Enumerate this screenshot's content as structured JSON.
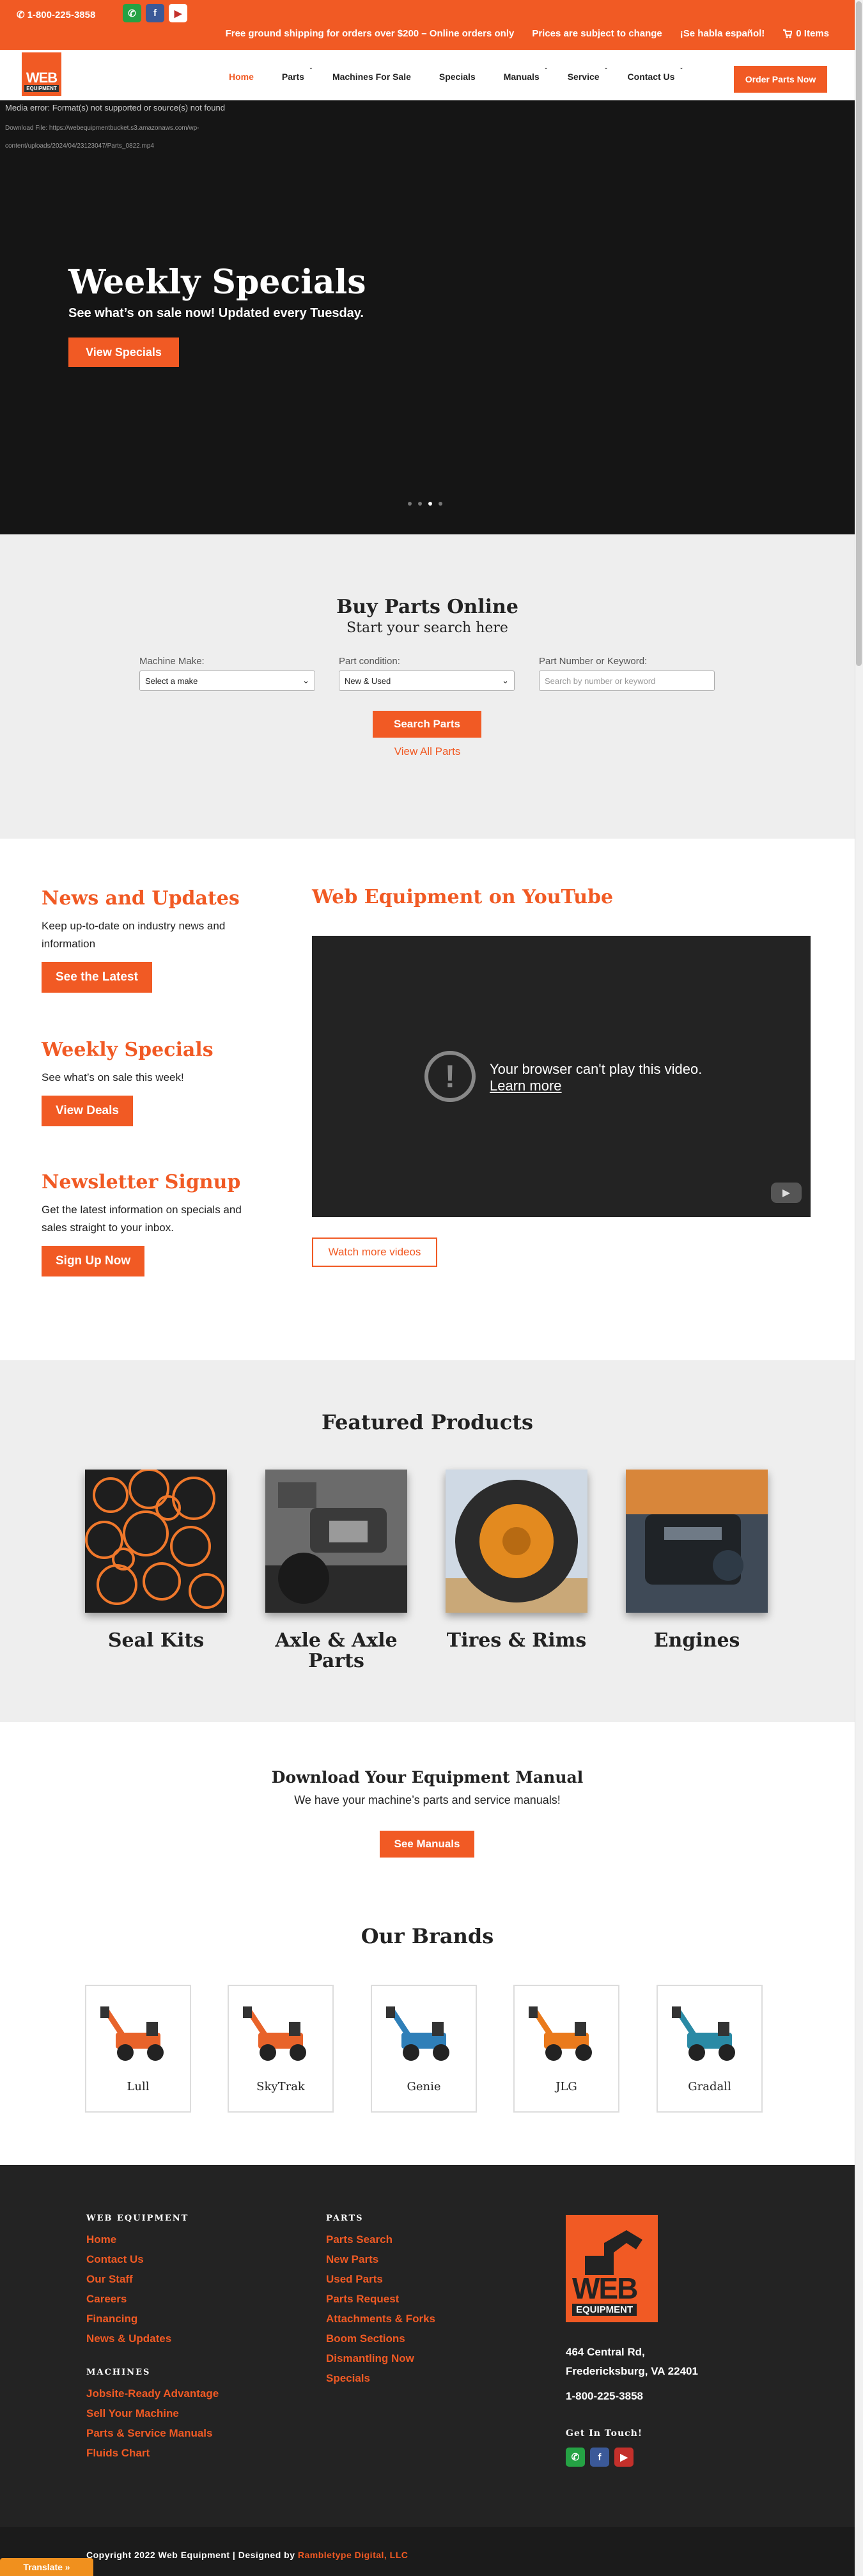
{
  "topbar": {
    "phone": "1-800-225-3858",
    "shipping": "Free ground shipping for orders over $200 – Online orders only",
    "prices": "Prices are subject to change",
    "spanish": "¡Se habla español!",
    "cart": "0 Items"
  },
  "header": {
    "logo_text": "WEB",
    "logo_sub": "EQUIPMENT",
    "nav": [
      "Home",
      "Parts",
      "Machines For Sale",
      "Specials",
      "Manuals",
      "Service",
      "Contact Us"
    ],
    "order_button": "Order Parts Now"
  },
  "hero": {
    "media_error": "Media error: Format(s) not supported or source(s) not found",
    "download_text": "Download File: https://webequipmentbucket.s3.amazonaws.com/wp-content/uploads/2024/04/23123047/Parts_0822.mp4",
    "title": "Weekly Specials",
    "subtitle": "See what’s on sale now! Updated every Tuesday.",
    "button": "View Specials",
    "active_slide": 3
  },
  "buy_parts": {
    "title": "Buy Parts Online",
    "subtitle": "Start your search here",
    "make_label": "Machine Make:",
    "make_value": "Select a make",
    "condition_label": "Part condition:",
    "condition_value": "New & Used",
    "keyword_label": "Part Number or Keyword:",
    "keyword_placeholder": "Search by number or keyword",
    "search_button": "Search Parts",
    "view_all": "View All Parts"
  },
  "news": {
    "news_title": "News and Updates",
    "news_text": "Keep up-to-date on industry news and information",
    "news_button": "See the Latest",
    "specials_title": "Weekly Specials",
    "specials_text": "See what’s on sale this week!",
    "specials_button": "View Deals",
    "newsletter_title": "Newsletter Signup",
    "newsletter_text": "Get the latest information on specials and sales straight to your inbox.",
    "newsletter_button": "Sign Up Now",
    "youtube_title": "Web Equipment on YouTube",
    "video_message": "Your browser can't play this video.",
    "video_learn": "Learn more",
    "watch_button": "Watch more videos"
  },
  "featured": {
    "title": "Featured Products",
    "products": [
      "Seal Kits",
      "Axle & Axle Parts",
      "Tires & Rims",
      "Engines"
    ]
  },
  "manuals": {
    "title": "Download Your Equipment Manual",
    "text": "We have your machine’s parts and service manuals!",
    "button": "See Manuals"
  },
  "brands": {
    "title": "Our Brands",
    "items": [
      {
        "name": "Lull",
        "color": "#e8632a"
      },
      {
        "name": "SkyTrak",
        "color": "#e8632a"
      },
      {
        "name": "Genie",
        "color": "#2f7fb8"
      },
      {
        "name": "JLG",
        "color": "#ea7a1c"
      },
      {
        "name": "Gradall",
        "color": "#2a8aa5"
      }
    ]
  },
  "footer": {
    "col1_heading": "WEB EQUIPMENT",
    "col1_links": [
      "Home",
      "Contact Us",
      "Our Staff",
      "Careers",
      "Financing",
      "News & Updates"
    ],
    "col1b_heading": "MACHINES",
    "col1b_links": [
      "Jobsite-Ready Advantage",
      "Sell Your Machine",
      "Parts & Service Manuals",
      "Fluids Chart"
    ],
    "col2_heading": "PARTS",
    "col2_links": [
      "Parts Search",
      "New Parts",
      "Used Parts",
      "Parts Request",
      "Attachments & Forks",
      "Boom Sections",
      "Dismantling Now",
      "Specials"
    ],
    "address1": "464 Central Rd,",
    "address2": "Fredericksburg, VA 22401",
    "phone": "1-800-225-3858",
    "get_in_touch": "Get In Touch!",
    "copyright": "Copyright 2022 Web Equipment | Designed by ",
    "designer": "Rambletype Digital, LLC",
    "translate": "Translate »"
  },
  "colors": {
    "accent": "#f15a24",
    "dark": "#232323"
  }
}
